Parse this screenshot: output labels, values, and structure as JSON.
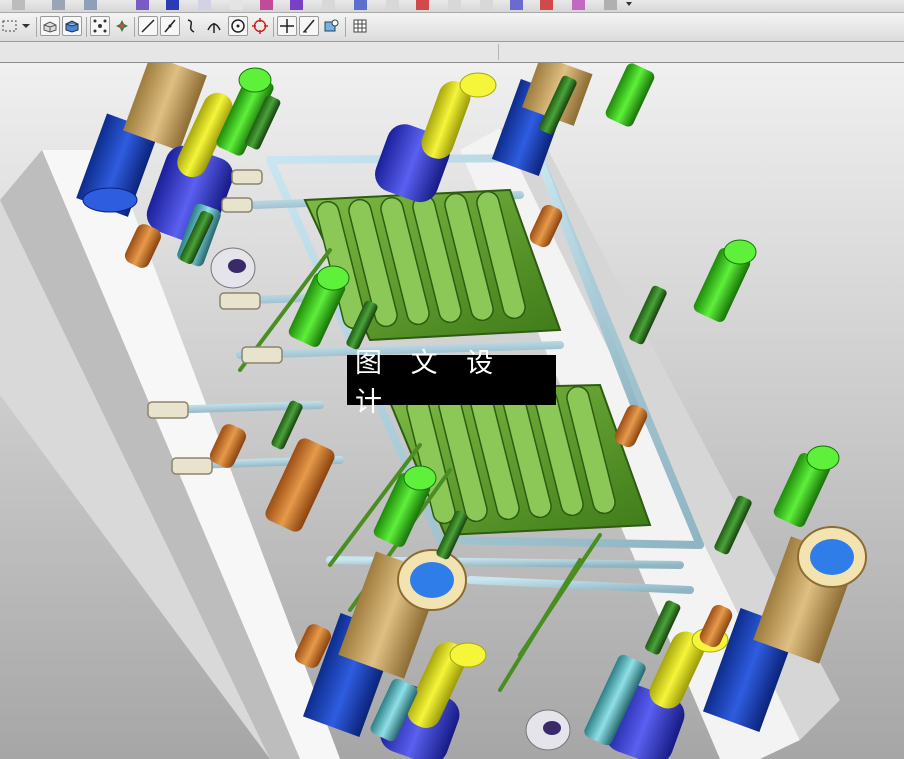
{
  "watermark": {
    "text": "图 文 设 计"
  },
  "toolbar": {
    "icons": [
      "rectangle-select-icon",
      "dropdown-arrow-icon",
      "box-wireframe-icon",
      "box-shaded-icon",
      "snap-points-icon",
      "snap-grid-icon",
      "line-icon",
      "diagonal-line-icon",
      "spline-icon",
      "intersection-icon",
      "circle-center-icon",
      "circle-target-icon",
      "crosshair-icon",
      "angle-line-icon",
      "point-view-icon",
      "table-icon"
    ]
  },
  "viewport": {
    "background_top": "#f2f2f2",
    "background_bottom": "#a8a8a8"
  },
  "colors": {
    "plate": "#f4f4f4",
    "plate_side": "#c9c9c9",
    "frame": "#b9d5df",
    "part_green": "#3f8f1b",
    "bolt_green": "#3bcf1b",
    "pillar_blue": "#1c3fb3",
    "spring_blue": "#3a3fd8",
    "tan": "#c9a25c",
    "yellow": "#e8e820",
    "orange": "#c8732a"
  }
}
